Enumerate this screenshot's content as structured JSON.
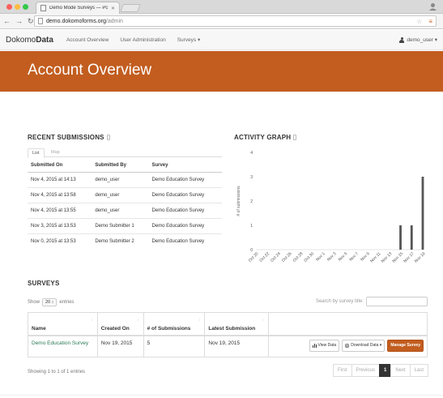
{
  "browser": {
    "tab_title": "Demo Mode Surveys — Po...",
    "url_host": "demo.dokomoforms.org",
    "url_path": "/admin"
  },
  "navbar": {
    "brand_light": "Dokomo",
    "brand_bold": "Data",
    "links": [
      "Account Overview",
      "User Administration",
      "Surveys ▾"
    ],
    "user": "demo_user ▾"
  },
  "banner": {
    "title": "Account Overview"
  },
  "recent": {
    "heading": "RECENT SUBMISSIONS",
    "tabs": [
      "List",
      "Map"
    ],
    "columns": [
      "Submitted On",
      "Submitted By",
      "Survey"
    ],
    "rows": [
      [
        "Nov 4, 2015 at 14:13",
        "demo_user",
        "Demo Education Survey"
      ],
      [
        "Nov 4, 2015 at 13:58",
        "demo_user",
        "Demo Education Survey"
      ],
      [
        "Nov 4, 2015 at 13:55",
        "demo_user",
        "Demo Education Survey"
      ],
      [
        "Nov 3, 2015 at 13:53",
        "Demo Submitter 1",
        "Demo Education Survey"
      ],
      [
        "Nov 0, 2015 at 13:53",
        "Demo Submitter 2",
        "Demo Education Survey"
      ]
    ]
  },
  "activity": {
    "heading": "ACTIVITY GRAPH"
  },
  "chart_data": {
    "type": "bar",
    "title": "",
    "xlabel": "",
    "ylabel": "# of submissions",
    "ylim": [
      0,
      4
    ],
    "yticks": [
      "0",
      "1",
      "2",
      "3",
      "4"
    ],
    "categories": [
      "Oct 20",
      "Oct 22",
      "Oct 24",
      "Oct 26",
      "Oct 28",
      "Oct 30",
      "Nov 1",
      "Nov 3",
      "Nov 5",
      "Nov 7",
      "Nov 9",
      "Nov 11",
      "Nov 13",
      "Nov 15",
      "Nov 17",
      "Nov 19"
    ],
    "values": [
      0,
      0,
      0,
      0,
      0,
      0,
      0,
      0,
      0,
      0,
      0,
      0,
      0,
      1,
      1,
      3
    ],
    "bar_color": "#555555"
  },
  "surveys": {
    "heading": "SURVEYS",
    "show_label": "Show",
    "show_value": "20 ↕",
    "entries_label": "entries",
    "search_label": "Search by survey title:",
    "columns": [
      "Name",
      "Created On",
      "# of Submissions",
      "Latest Submission"
    ],
    "rows": [
      {
        "name": "Demo Education Survey",
        "created": "Nov 19, 2015",
        "submissions": "5",
        "latest": "Nov 19, 2015"
      }
    ],
    "actions": {
      "view": "View Data",
      "download": "Download Data ▾",
      "manage": "Manage Survey"
    },
    "info": "Showing 1 to 1 of 1 entries",
    "pager": [
      "First",
      "Previous",
      "1",
      "Next",
      "Last"
    ]
  },
  "colors": {
    "accent": "#c25d1f",
    "link": "#2a7a55"
  }
}
